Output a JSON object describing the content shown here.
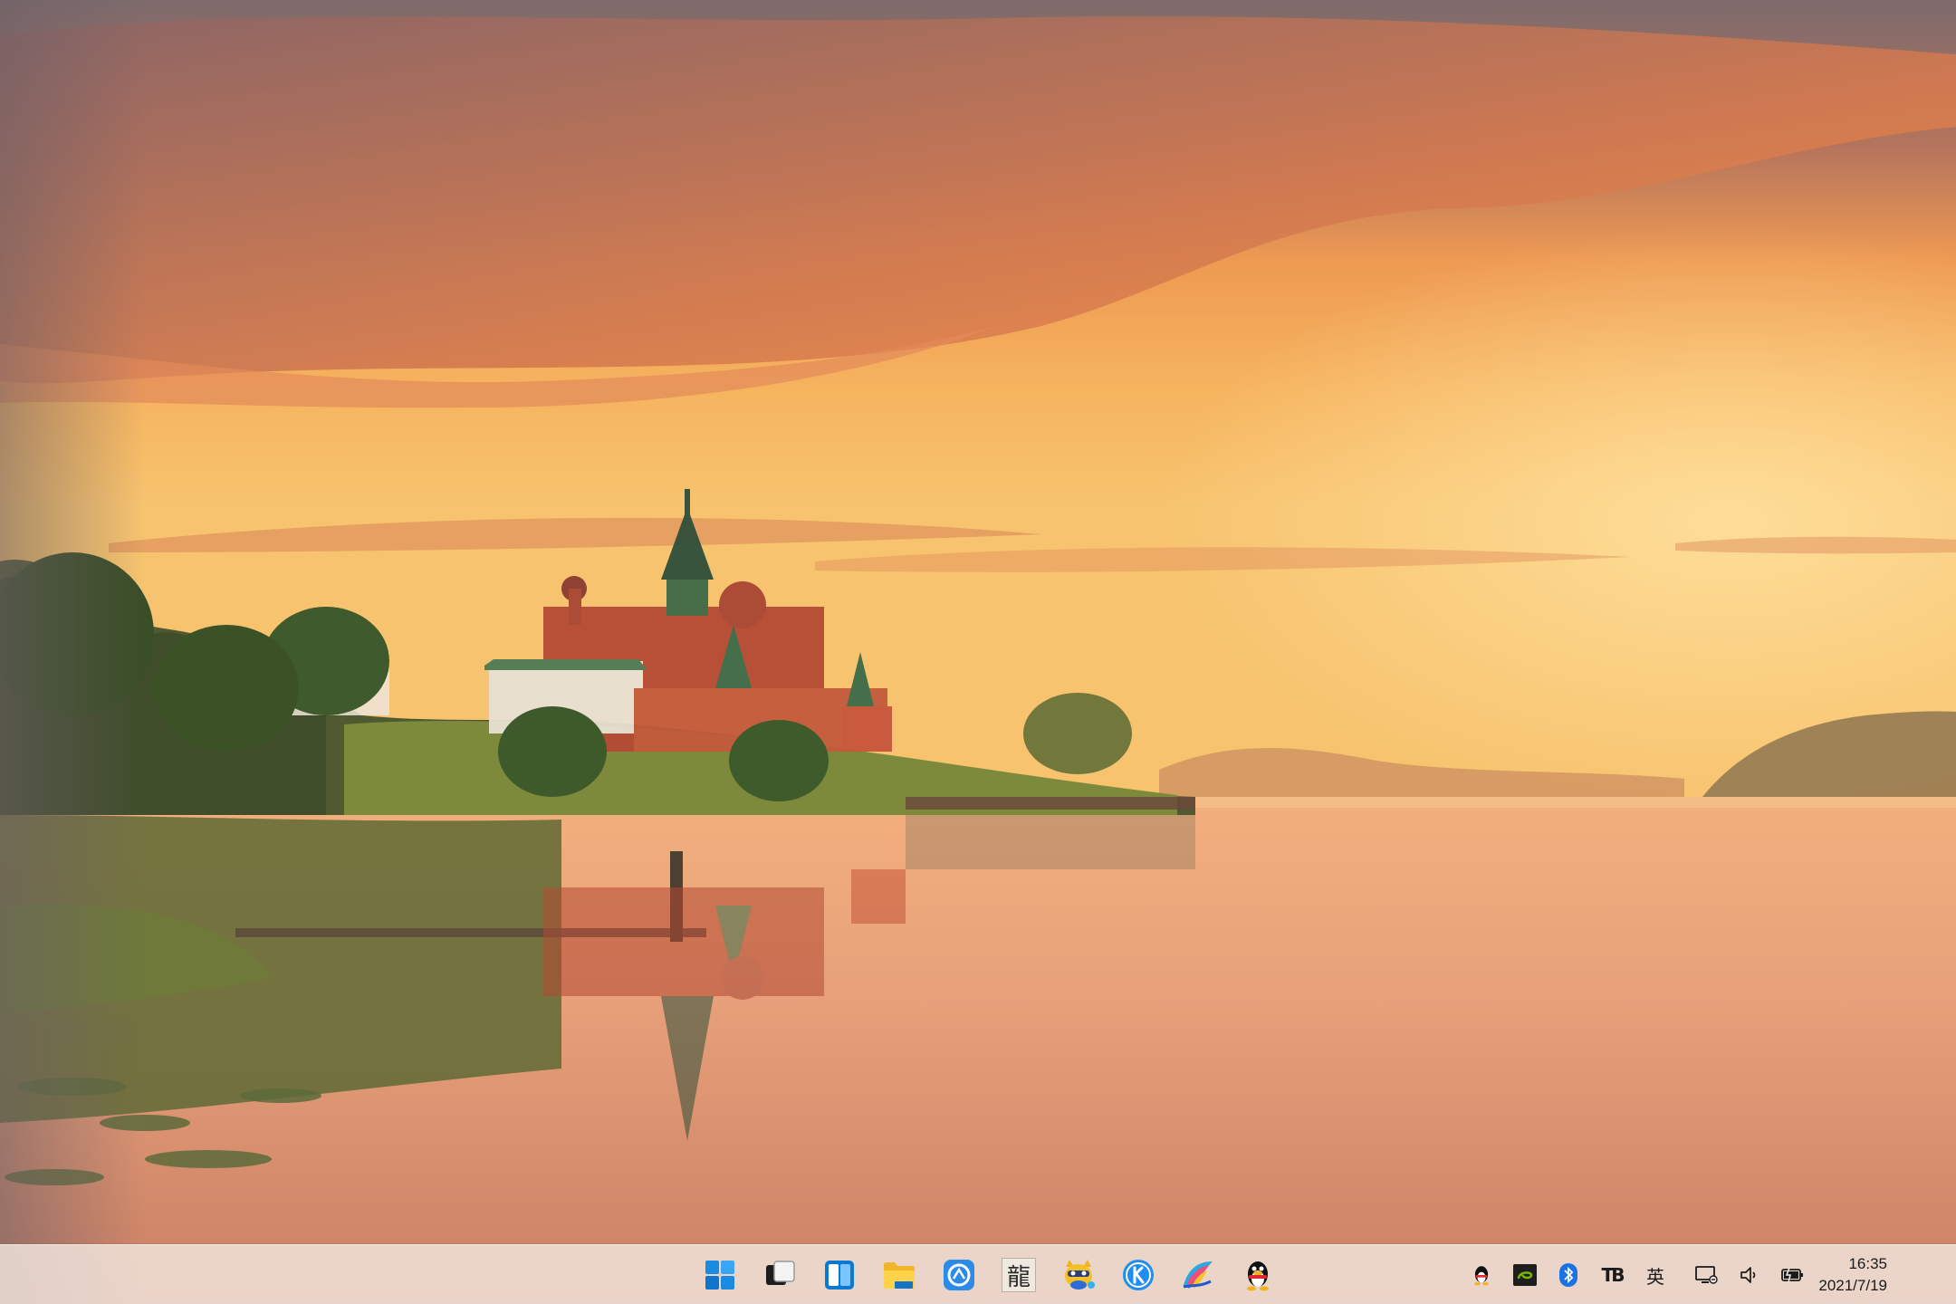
{
  "wallpaper": {
    "colors": {
      "sky_top": "#8a6e6a",
      "sky_mid": "#f0a24e",
      "horizon": "#f7c26a",
      "water": "#e39a70"
    }
  },
  "taskbar": {
    "background": "#f3e9e1",
    "pinned": [
      {
        "name": "start-button",
        "icon": "windows-logo-icon"
      },
      {
        "name": "task-view-button",
        "icon": "task-view-icon"
      },
      {
        "name": "widgets-button",
        "icon": "widgets-icon"
      },
      {
        "name": "file-explorer-button",
        "icon": "folder-icon"
      },
      {
        "name": "browser-button",
        "icon": "browser-icon"
      },
      {
        "name": "dragon-app-button",
        "icon": "dragon-character-icon"
      },
      {
        "name": "cat-app-button",
        "icon": "cat-mascot-icon"
      },
      {
        "name": "kugou-music-button",
        "icon": "k-music-icon"
      },
      {
        "name": "colorful-app-button",
        "icon": "colorful-bird-icon"
      },
      {
        "name": "qq-button",
        "icon": "qq-penguin-icon"
      }
    ],
    "dragon_char": "龍",
    "tray": {
      "icons": [
        "qq-tray-icon",
        "nvidia-icon",
        "bluetooth-icon",
        "tb-icon"
      ],
      "tb_label": "TB",
      "ime_label": "英",
      "status_icons": [
        "network-icon",
        "volume-icon",
        "battery-icon"
      ]
    },
    "clock": {
      "time": "16:35",
      "date": "2021/7/19"
    }
  }
}
